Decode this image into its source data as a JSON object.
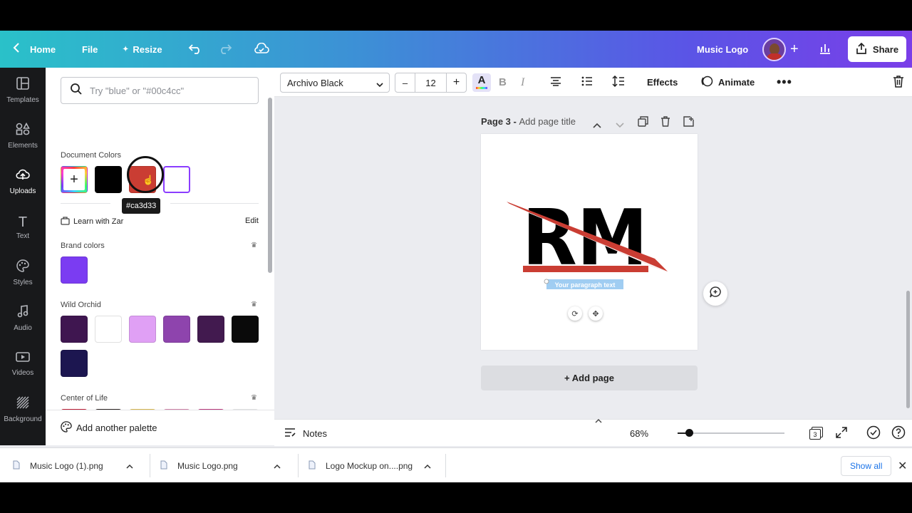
{
  "topbar": {
    "home": "Home",
    "file": "File",
    "resize": "Resize",
    "design_title": "Music Logo",
    "share": "Share",
    "icons": [
      "chevron-left-icon",
      "crown-icon",
      "undo-icon",
      "redo-icon",
      "cloud-sync-icon",
      "plus-icon",
      "bar-chart-icon",
      "share-icon"
    ]
  },
  "rail": {
    "items": [
      {
        "label": "Templates",
        "icon": "templates-icon"
      },
      {
        "label": "Elements",
        "icon": "elements-icon"
      },
      {
        "label": "Uploads",
        "icon": "uploads-icon"
      },
      {
        "label": "Text",
        "icon": "text-icon"
      },
      {
        "label": "Styles",
        "icon": "styles-icon"
      },
      {
        "label": "Audio",
        "icon": "audio-icon"
      },
      {
        "label": "Videos",
        "icon": "videos-icon"
      },
      {
        "label": "Background",
        "icon": "background-icon"
      }
    ],
    "active": "Uploads"
  },
  "panel": {
    "search_placeholder": "Try \"blue\" or \"#00c4cc\"",
    "document_colors_label": "Document Colors",
    "document_colors": [
      "#000000",
      "#ca3d33",
      "#ffffff"
    ],
    "tooltip": "#ca3d33",
    "learn_label": "Learn with Zar",
    "edit_label": "Edit",
    "brand_colors_label": "Brand colors",
    "brand_colors": [
      "#7b3cf2"
    ],
    "palettes": [
      {
        "name": "Wild Orchid",
        "colors": [
          "#3f1650",
          "#ffffff",
          "#e0a0f5",
          "#8e44ad",
          "#421a4f",
          "#0a0a0a",
          "#1c1650"
        ]
      },
      {
        "name": "Center of Life",
        "colors": [
          "#d6243f",
          "#362c2a",
          "#f5d05a",
          "#ea93be",
          "#d3408e",
          "#ffffff"
        ]
      }
    ],
    "add_palette": "Add another palette"
  },
  "toolbar": {
    "font": "Archivo Black",
    "font_size": "12",
    "minus": "–",
    "plus": "+",
    "effects": "Effects",
    "animate": "Animate",
    "text_color": "#ca3d33"
  },
  "canvas": {
    "page_label": "Page 3 - ",
    "page_title_placeholder": "Add page title",
    "logo_text": "RM",
    "paragraph": "Your paragraph text",
    "add_page": "+ Add page",
    "logo_colors": {
      "letters": "#000000",
      "accent": "#ca3d33"
    }
  },
  "bottombar": {
    "notes": "Notes",
    "zoom": "68%",
    "zoom_level": 0.68,
    "page_count": "3"
  },
  "downloads": {
    "files": [
      "Music Logo (1).png",
      "Music Logo.png",
      "Logo Mockup on....png"
    ],
    "show_all": "Show all"
  }
}
